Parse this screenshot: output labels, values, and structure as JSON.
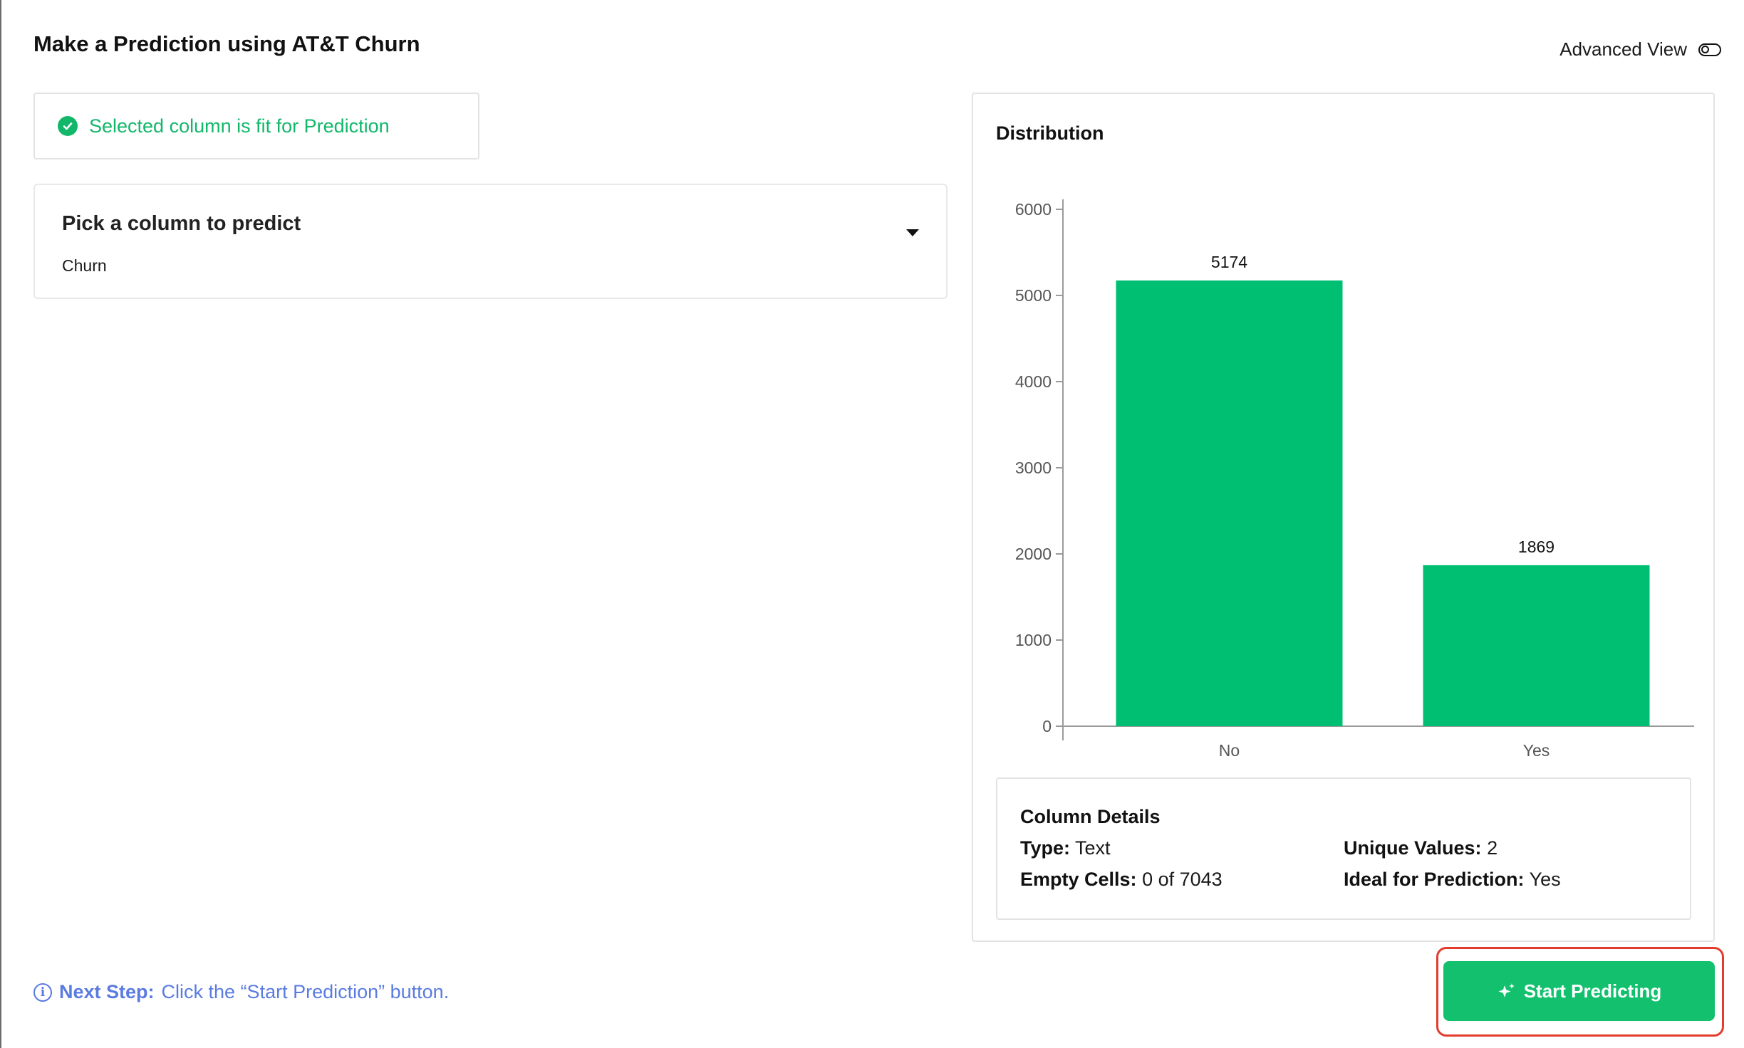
{
  "header": {
    "title": "Make a Prediction using AT&T Churn",
    "advanced_view_label": "Advanced View",
    "advanced_view_on": false
  },
  "status": {
    "message": "Selected column is fit for Prediction",
    "color": "#12b76a",
    "icon": "check-circle-icon"
  },
  "column_picker": {
    "label": "Pick a column to predict",
    "selected": "Churn",
    "icon": "caret-down-icon"
  },
  "distribution": {
    "title": "Distribution"
  },
  "chart_data": {
    "type": "bar",
    "categories": [
      "No",
      "Yes"
    ],
    "values": [
      5174,
      1869
    ],
    "data_labels": [
      "5174",
      "1869"
    ],
    "title": "Distribution",
    "xlabel": "",
    "ylabel": "",
    "ylim": [
      0,
      6000
    ],
    "yticks": [
      0,
      1000,
      2000,
      3000,
      4000,
      5000,
      6000
    ],
    "grid": false,
    "color": "#00bf73"
  },
  "column_details": {
    "title": "Column Details",
    "type_label": "Type:",
    "type_value": "Text",
    "empty_label": "Empty Cells:",
    "empty_value": "0 of 7043",
    "unique_label": "Unique Values:",
    "unique_value": "2",
    "ideal_label": "Ideal for Prediction:",
    "ideal_value": "Yes"
  },
  "footer": {
    "next_step_label": "Next Step:",
    "next_step_text": "Click the “Start Prediction” button.",
    "info_icon": "info-icon",
    "start_button_label": "Start Predicting",
    "start_button_icon": "sparkle-icon",
    "accent": "#12c06e",
    "highlight_color": "#e33b2e"
  }
}
